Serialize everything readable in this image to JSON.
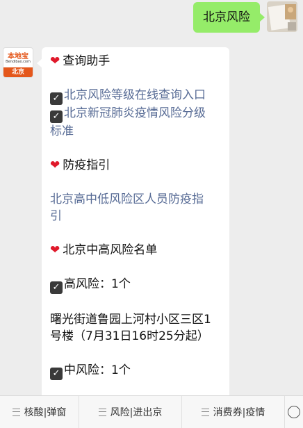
{
  "user_message": {
    "text": "北京风险"
  },
  "bot": {
    "avatar": {
      "brand": "本地宝",
      "site": "Bendibao.com",
      "city": "北京"
    },
    "section_assistant": "查询助手",
    "link_risk_level_query": "北京风险等级在线查询入口",
    "link_risk_standard_line1": "北京新冠肺炎疫情风险分级",
    "link_risk_standard_line2": "标准",
    "section_guide": "防疫指引",
    "link_guide_line1": "北京高中低风险区人员防疫指",
    "link_guide_line2": "引",
    "section_list": "北京中高风险名单",
    "high_risk_label": "高风险：1个",
    "high_risk_area_line1": "曙光街道鲁园上河村小区三区1",
    "high_risk_area_line2": "号楼（7月31日16时25分起）",
    "mid_risk_label": "中风险：1个"
  },
  "menu": {
    "items": [
      {
        "label": "核酸|弹窗"
      },
      {
        "label": "风险|进出京"
      },
      {
        "label": "消费券|疫情"
      }
    ]
  },
  "icons": {
    "heart": "heart-icon",
    "check": "checkbox-icon",
    "menu": "menu-lines-icon",
    "keyboard": "keyboard-icon"
  },
  "colors": {
    "user_bubble": "#95ec69",
    "link": "#576b95",
    "heart": "#e0192b",
    "brand_orange": "#e4571b"
  }
}
